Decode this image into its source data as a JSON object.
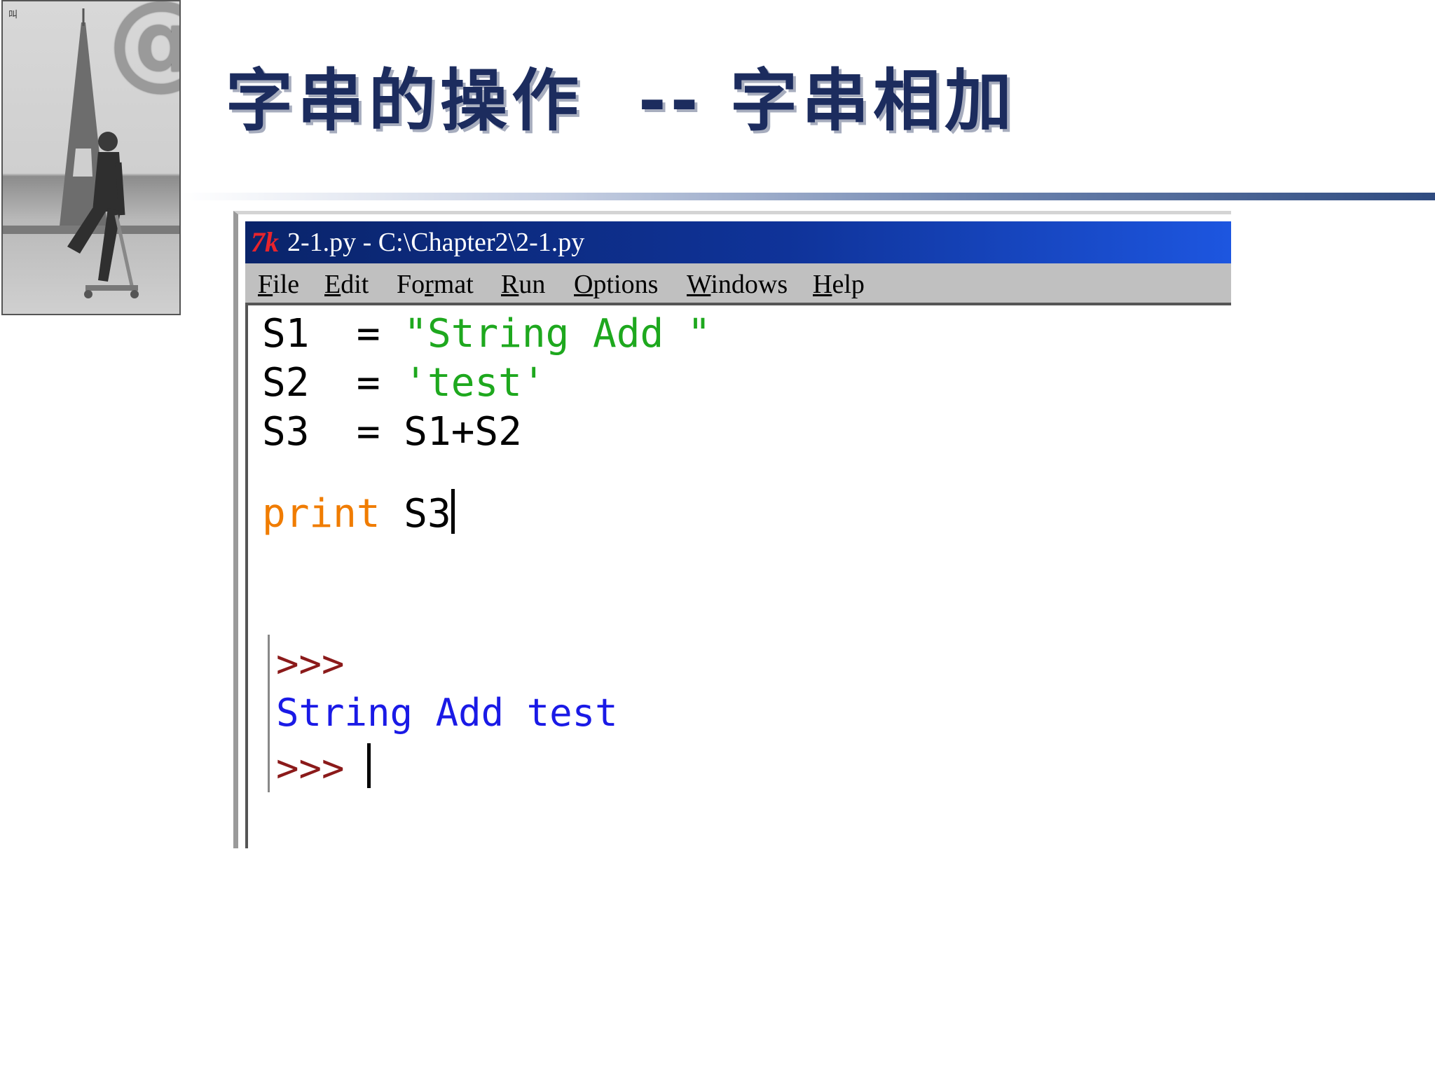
{
  "slide": {
    "title": "字串的操作  -- 字串相加",
    "photo_tag": "叫",
    "at_symbol": "@"
  },
  "window": {
    "title": "2-1.py - C:\\Chapter2\\2-1.py",
    "icon": "tk-icon",
    "icon_text": "7k"
  },
  "menu": [
    {
      "pre": "",
      "u": "F",
      "post": "ile"
    },
    {
      "pre": "",
      "u": "E",
      "post": "dit"
    },
    {
      "pre": "Fo",
      "u": "r",
      "post": "mat"
    },
    {
      "pre": "",
      "u": "R",
      "post": "un"
    },
    {
      "pre": "",
      "u": "O",
      "post": "ptions"
    },
    {
      "pre": "",
      "u": "W",
      "post": "indows"
    },
    {
      "pre": "",
      "u": "H",
      "post": "elp"
    }
  ],
  "code": {
    "line1_lhs": "S1  = ",
    "line1_str": "\"String Add \"",
    "line2_lhs": "S2  = ",
    "line2_str": "'test'",
    "line3": "S3  = S1+S2",
    "line4_kw": "print",
    "line4_rest": " S3"
  },
  "shell": {
    "prompt1": ">>>",
    "output": "String Add test",
    "prompt2": ">>> "
  },
  "colors": {
    "title": "#1c2c5e",
    "string": "#1ea81e",
    "keyword": "#f07c00",
    "prompt": "#8b1a1a",
    "output": "#1a1ae6",
    "titlebar": "#0a246a"
  }
}
